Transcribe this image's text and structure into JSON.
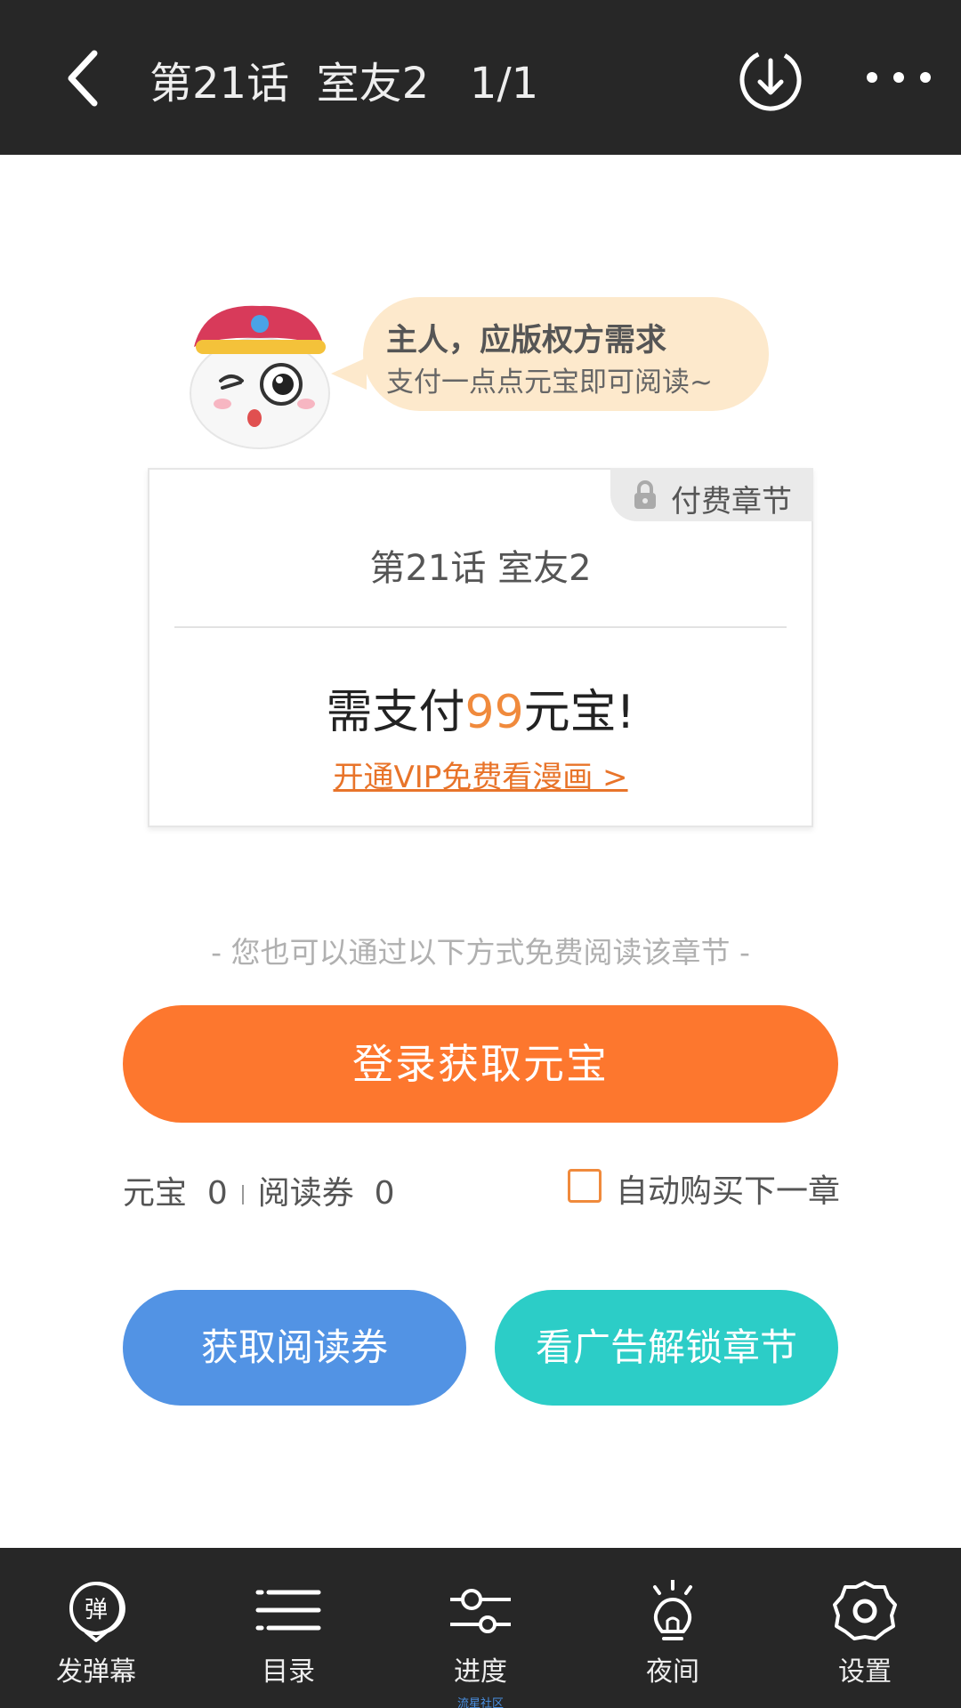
{
  "header": {
    "title": "第21话  室友2   1/1",
    "back_icon": "back-arrow-icon",
    "download_icon": "download-icon",
    "more_icon": "more-dots-icon"
  },
  "bubble": {
    "line1": "主人，应版权方需求",
    "line2": "支付一点点元宝即可阅读~"
  },
  "card": {
    "tag": "付费章节",
    "chapter_title": "第21话  室友2",
    "price_prefix": "需支付",
    "price_value": "99",
    "price_suffix": "元宝!",
    "vip_link": "开通VIP免费看漫画 >"
  },
  "free_hint": "- 您也可以通过以下方式免费阅读该章节 -",
  "login_button": "登录获取元宝",
  "balance": {
    "yuanbao": "元宝  0",
    "voucher": "阅读券  0"
  },
  "auto_buy": {
    "label": "自动购买下一章",
    "checked": false,
    "accent": "#f08a3c"
  },
  "buttons": {
    "get_voucher": "获取阅读券",
    "watch_ad": "看广告解锁章节"
  },
  "bottom_nav": [
    {
      "label": "发弹幕",
      "icon": "danmaku-icon",
      "glyph": "弹"
    },
    {
      "label": "目录",
      "icon": "list-icon"
    },
    {
      "label": "进度",
      "icon": "progress-slider-icon"
    },
    {
      "label": "夜间",
      "icon": "night-bulb-icon"
    },
    {
      "label": "设置",
      "icon": "gear-icon"
    }
  ],
  "community_text": "流星社区",
  "colors": {
    "bar": "#272727",
    "orange": "#fd772e",
    "blue": "#5293e4",
    "teal": "#2ccdc7",
    "bubble": "#fde9cc"
  }
}
